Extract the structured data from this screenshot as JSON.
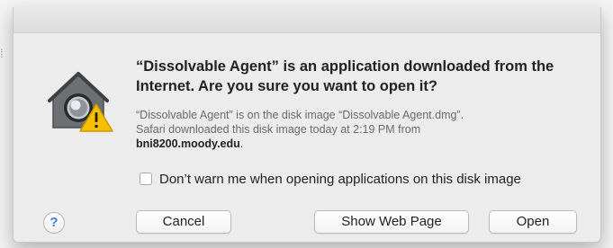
{
  "dialog": {
    "heading": "“Dissolvable Agent” is an application downloaded from the Internet. Are you sure you want to open it?",
    "info_line1": "“Dissolvable Agent” is on the disk image “Dissolvable Agent.dmg”.",
    "info_line2": "Safari downloaded this disk image today at 2:19 PM from",
    "info_host": "bni8200.moody.edu",
    "info_host_suffix": ".",
    "checkbox_label": "Don’t warn me when opening applications on this disk image",
    "checkbox_checked": false,
    "help_label": "?",
    "buttons": {
      "cancel": "Cancel",
      "show_web_page": "Show Web Page",
      "open": "Open"
    },
    "icon": "gatekeeper-warning-icon"
  },
  "colors": {
    "dialog_bg": "#ececec",
    "warning_yellow": "#f5c000",
    "help_blue": "#3b7fe0"
  }
}
